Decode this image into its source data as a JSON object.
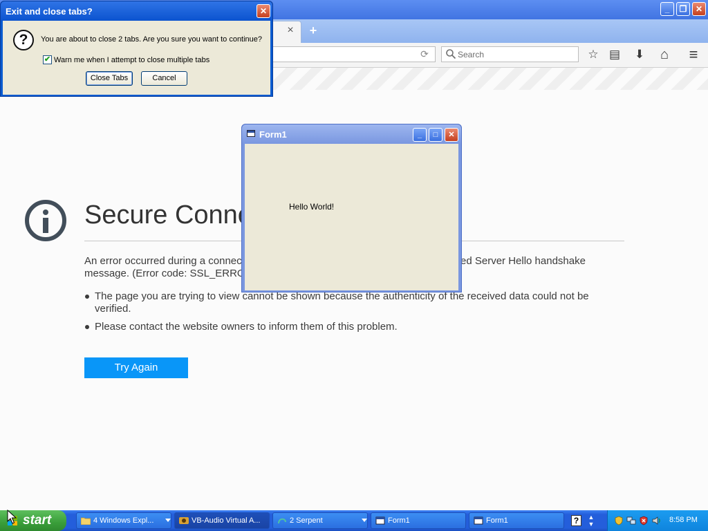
{
  "browser": {
    "search_placeholder": "Search",
    "tab_close_glyph": "×",
    "new_tab_glyph": "+",
    "reload_glyph": "⟳",
    "bookmark_star_glyph": "☆",
    "reading_list_glyph": "▤",
    "downloads_glyph": "⬇",
    "home_glyph": "⌂",
    "menu_glyph": "≡"
  },
  "error_page": {
    "title": "Secure Conne",
    "desc_line1_left": "An error occurred during a connect",
    "desc_line1_right": "ed Server Hello handshake",
    "desc_line2": "message. (Error code: SSL_ERROR",
    "bullet1_line1": "The page you are trying to view cannot be shown because the authenticity of the received data could not be",
    "bullet1_line2": "verified.",
    "bullet2": "Please contact the website owners to inform them of this problem.",
    "try_again": "Try Again"
  },
  "form1": {
    "title": "Form1",
    "label": "Hello World!"
  },
  "dialog": {
    "title": "Exit and close tabs?",
    "message": "You are about to close 2 tabs. Are you sure you want to continue?",
    "checkbox_label": "Warn me when I attempt to close multiple tabs",
    "checkbox_checked": true,
    "close_tabs": "Close Tabs",
    "cancel": "Cancel"
  },
  "taskbar": {
    "start": "start",
    "items": [
      {
        "label": "4 Windows Expl..."
      },
      {
        "label": "VB-Audio Virtual A..."
      },
      {
        "label": "2 Serpent"
      },
      {
        "label": "Form1"
      },
      {
        "label": "Form1"
      }
    ],
    "clock": "8:58 PM"
  },
  "colors": {
    "accent_blue": "#0996f8",
    "xp_taskbar": "#245edb",
    "xp_start_green": "#3a9e3a",
    "xp_close_red": "#c4401f",
    "dialog_face": "#ece9d8"
  }
}
